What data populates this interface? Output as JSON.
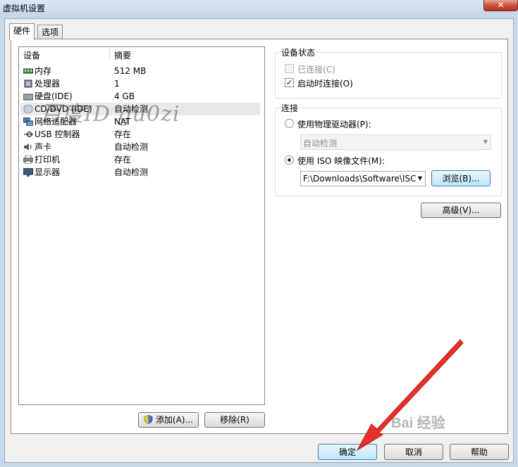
{
  "window": {
    "title": "虚拟机设置",
    "close_glyph": "✕"
  },
  "tabs": [
    {
      "label": "硬件"
    },
    {
      "label": "选项"
    }
  ],
  "device_list": {
    "col_device": "设备",
    "col_summary": "摘要",
    "rows": [
      {
        "name": "内存",
        "summary": "512 MB",
        "icon": "memory-icon"
      },
      {
        "name": "处理器",
        "summary": "1",
        "icon": "processor-icon"
      },
      {
        "name": "硬盘(IDE)",
        "summary": "4 GB",
        "icon": "hard-disk-icon"
      },
      {
        "name": "CD/DVD (IDE)",
        "summary": "自动检测",
        "icon": "cd-dvd-icon"
      },
      {
        "name": "网络适配器",
        "summary": "NAT",
        "icon": "network-adapter-icon"
      },
      {
        "name": "USB 控制器",
        "summary": "存在",
        "icon": "usb-icon"
      },
      {
        "name": "声卡",
        "summary": "自动检测",
        "icon": "sound-card-icon"
      },
      {
        "name": "打印机",
        "summary": "存在",
        "icon": "printer-icon"
      },
      {
        "name": "显示器",
        "summary": "自动检测",
        "icon": "display-icon"
      }
    ],
    "selected_index": 3
  },
  "list_buttons": {
    "add": "添加(A)...",
    "remove": "移除(R)"
  },
  "device_status": {
    "title": "设备状态",
    "connected": {
      "label": "已连接(C)",
      "checked": false,
      "enabled": false
    },
    "connect_on_start": {
      "label": "启动时连接(O)",
      "checked": true
    }
  },
  "connection": {
    "title": "连接",
    "physical": {
      "label": "使用物理驱动器(P):",
      "selected": false,
      "value": "自动检测"
    },
    "iso": {
      "label": "使用 ISO 映像文件(M):",
      "selected": true,
      "value": "F:\\Downloads\\Software\\ISC"
    },
    "browse": "浏览(B)..."
  },
  "advanced": "高级(V)...",
  "footer": {
    "ok": "确定",
    "cancel": "取消",
    "help": "帮助"
  },
  "overlays": {
    "watermark": "百度ID  gu0zi",
    "baidu_logo": "Bai 经验",
    "arrow_color": "#e8302a"
  }
}
